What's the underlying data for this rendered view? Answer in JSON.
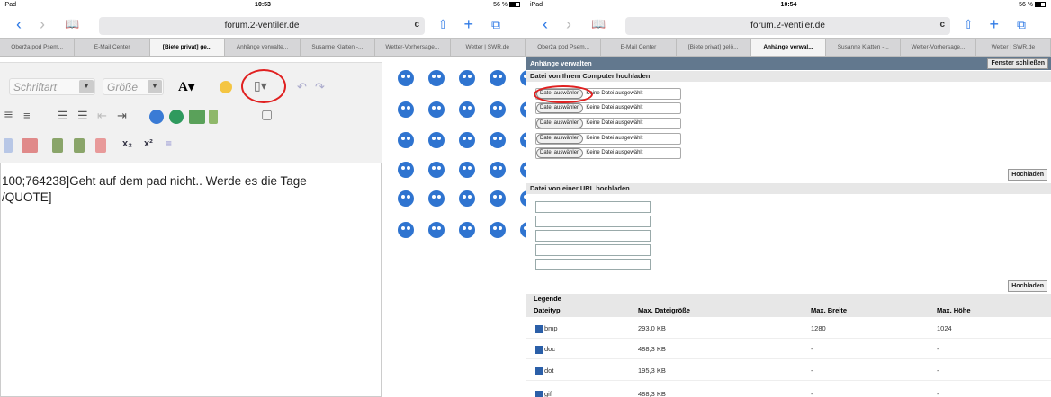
{
  "left": {
    "status": {
      "left": "iPad",
      "time": "10:53",
      "battery": "56 %"
    },
    "url": "forum.2-ventiler.de",
    "tabs": [
      "Oberža pod Psem...",
      "E-Mail Center",
      "[Biete privat] ge...",
      "Anhänge verwalte...",
      "Susanne Klatten -...",
      "Wetter-Vorhersage...",
      "Wetter | SWR.de"
    ],
    "active_tab": 2,
    "toolbar": {
      "font_label": "Schriftart",
      "size_label": "Größe"
    },
    "editor_text_line1": "100;764238]Geht auf dem pad nicht.. Werde es die Tage",
    "editor_text_line2": "/QUOTE]"
  },
  "right": {
    "status": {
      "left": "iPad",
      "time": "10:54",
      "battery": "56 %"
    },
    "url": "forum.2-ventiler.de",
    "tabs": [
      "Oberža pod Psem...",
      "E-Mail Center",
      "[Biete privat] gelö...",
      "Anhänge verwal...",
      "Susanne Klatten -...",
      "Wetter-Vorhersage...",
      "Wetter | SWR.de"
    ],
    "active_tab": 3,
    "window_title": "Anhänge verwalten",
    "close_label": "Fenster schließen",
    "computer_upload_title": "Datei von Ihrem Computer hochladen",
    "file_button_label": "Datei auswählen",
    "file_status": "Keine Datei ausgewählt",
    "upload_label": "Hochladen",
    "url_upload_title": "Datei von einer URL hochladen",
    "legend_title": "Legende",
    "columns": [
      "Dateityp",
      "Max. Dateigröße",
      "Max. Breite",
      "Max. Höhe"
    ],
    "rows": [
      {
        "type": "bmp",
        "size": "293,0 KB",
        "width": "1280",
        "height": "1024"
      },
      {
        "type": "doc",
        "size": "488,3 KB",
        "width": "-",
        "height": "-"
      },
      {
        "type": "dot",
        "size": "195,3 KB",
        "width": "-",
        "height": "-"
      },
      {
        "type": "gif",
        "size": "488,3 KB",
        "width": "-",
        "height": "-"
      }
    ]
  },
  "colors": {
    "accent": "#2f7ae5",
    "header_bar": "#62788e",
    "highlight_circle": "#e02020"
  }
}
